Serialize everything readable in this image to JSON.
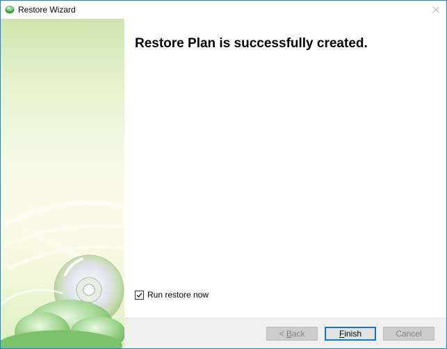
{
  "window": {
    "title": "Restore Wizard"
  },
  "main": {
    "heading": "Restore Plan is successfully created.",
    "run_restore_label": "Run restore now",
    "run_restore_checked": true
  },
  "buttons": {
    "back": {
      "prefix": "< ",
      "accel": "B",
      "rest": "ack"
    },
    "finish": {
      "accel": "F",
      "rest": "inish"
    },
    "cancel": {
      "label": "Cancel"
    }
  },
  "icons": {
    "app": "restore-globe-icon",
    "close": "close-icon",
    "checkbox": "checkmark-icon",
    "side_art": "disc-cloud-illustration"
  },
  "colors": {
    "window_border": "#1883d7",
    "side_panel_top": "#cfe5b0",
    "side_panel_bottom": "#dcefc1",
    "footer_bg": "#f0f0f0",
    "focus_border": "#0078d7"
  }
}
